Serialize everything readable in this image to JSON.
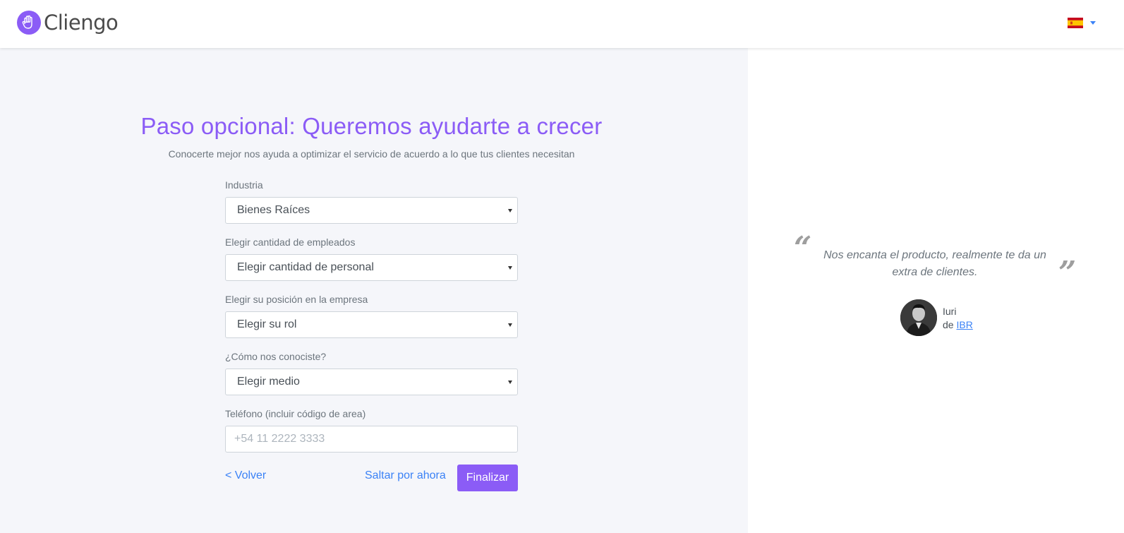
{
  "header": {
    "logo_text": "Cliengo",
    "logo_icon": "hand-icon",
    "language_flag": "spain-flag-icon",
    "language_caret": "caret-down-icon"
  },
  "form": {
    "title": "Paso opcional: Queremos ayudarte a crecer",
    "subtitle": "Conocerte mejor nos ayuda a optimizar el servicio de acuerdo a lo que tus clientes necesitan",
    "fields": {
      "industry": {
        "label": "Industria",
        "value": "Bienes Raíces"
      },
      "employees": {
        "label": "Elegir cantidad de empleados",
        "value": "Elegir cantidad de personal"
      },
      "position": {
        "label": "Elegir su posición en la empresa",
        "value": "Elegir su rol"
      },
      "source": {
        "label": "¿Cómo nos conociste?",
        "value": "Elegir medio"
      },
      "phone": {
        "label": "Teléfono (incluir código de area)",
        "value": "",
        "placeholder": "+54 11 2222 3333"
      }
    },
    "back_label": "< Volver",
    "skip_label": "Saltar por ahora",
    "finish_label": "Finalizar"
  },
  "testimonial": {
    "quote": "Nos encanta el producto, realmente te da un extra de clientes.",
    "author_name": "Iuri",
    "author_prefix": "de",
    "author_company": "IBR"
  },
  "colors": {
    "accent": "#8b5cf6",
    "link": "#3b82f6",
    "background_left": "#f5f6fa",
    "background_right": "#ffffff"
  }
}
